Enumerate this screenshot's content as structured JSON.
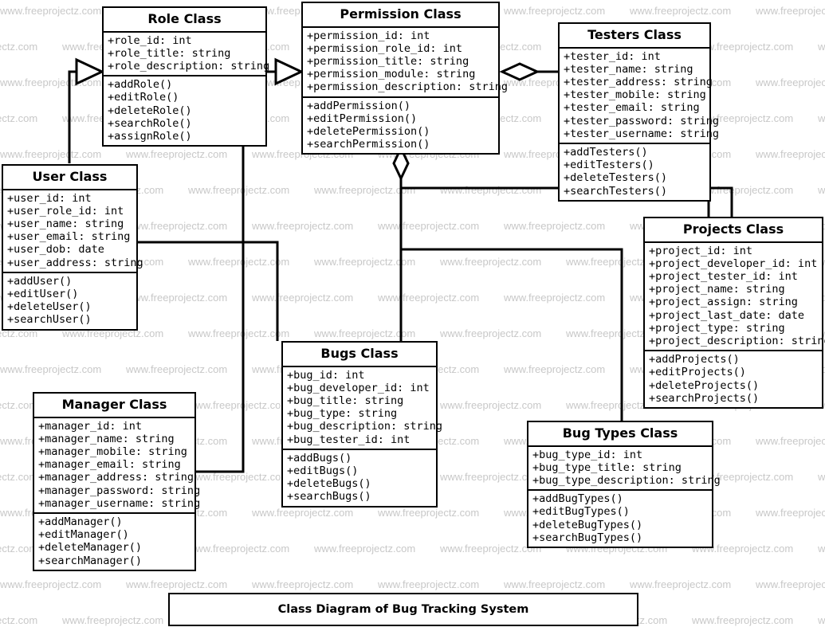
{
  "diagram": {
    "caption": "Class Diagram of Bug Tracking System",
    "watermark_text": "www.freeprojectz.com",
    "line_color": "#000000",
    "box_fill": "#ffffff",
    "watermark_color": "#c8c8c8"
  },
  "classes": {
    "role": {
      "title": "Role Class",
      "attributes": [
        "+role_id: int",
        "+role_title: string",
        "+role_description: string"
      ],
      "methods": [
        "+addRole()",
        "+editRole()",
        "+deleteRole()",
        "+searchRole()",
        "+assignRole()"
      ]
    },
    "permission": {
      "title": "Permission Class",
      "attributes": [
        "+permission_id: int",
        "+permission_role_id: int",
        "+permission_title: string",
        "+permission_module: string",
        "+permission_description: string"
      ],
      "methods": [
        "+addPermission()",
        "+editPermission()",
        "+deletePermission()",
        "+searchPermission()"
      ]
    },
    "testers": {
      "title": "Testers Class",
      "attributes": [
        "+tester_id: int",
        "+tester_name: string",
        "+tester_address: string",
        "+tester_mobile: string",
        "+tester_email: string",
        "+tester_password: string",
        "+tester_username: string"
      ],
      "methods": [
        "+addTesters()",
        "+editTesters()",
        "+deleteTesters()",
        "+searchTesters()"
      ]
    },
    "user": {
      "title": "User Class",
      "attributes": [
        "+user_id: int",
        "+user_role_id: int",
        "+user_name: string",
        "+user_email: string",
        "+user_dob: date",
        "+user_address: string"
      ],
      "methods": [
        "+addUser()",
        "+editUser()",
        "+deleteUser()",
        "+searchUser()"
      ]
    },
    "projects": {
      "title": "Projects Class",
      "attributes": [
        "+project_id: int",
        "+project_developer_id: int",
        "+project_tester_id: int",
        "+project_name: string",
        "+project_assign: string",
        "+project_last_date: date",
        "+project_type: string",
        "+project_description: string"
      ],
      "methods": [
        "+addProjects()",
        "+editProjects()",
        "+deleteProjects()",
        "+searchProjects()"
      ]
    },
    "bugs": {
      "title": "Bugs Class",
      "attributes": [
        "+bug_id: int",
        "+bug_developer_id: int",
        "+bug_title: string",
        "+bug_type: string",
        "+bug_description: string",
        "+bug_tester_id: int"
      ],
      "methods": [
        "+addBugs()",
        "+editBugs()",
        "+deleteBugs()",
        "+searchBugs()"
      ]
    },
    "manager": {
      "title": "Manager Class",
      "attributes": [
        "+manager_id: int",
        "+manager_name: string",
        "+manager_mobile: string",
        "+manager_email: string",
        "+manager_address: string",
        "+manager_password: string",
        "+manager_username: string"
      ],
      "methods": [
        "+addManager()",
        "+editManager()",
        "+deleteManager()",
        "+searchManager()"
      ]
    },
    "bugtypes": {
      "title": "Bug Types Class",
      "attributes": [
        "+bug_type_id: int",
        "+bug_type_title: string",
        "+bug_type_description: string"
      ],
      "methods": [
        "+addBugTypes()",
        "+editBugTypes()",
        "+deleteBugTypes()",
        "+searchBugTypes()"
      ]
    }
  },
  "relationships": [
    {
      "from": "user",
      "to": "role",
      "marker": "hollow-triangle"
    },
    {
      "from": "role",
      "to": "permission",
      "marker": "hollow-triangle"
    },
    {
      "from": "testers",
      "to": "permission",
      "marker": "hollow-diamond"
    },
    {
      "from": "permission",
      "to": "bugs",
      "marker": "hollow-diamond"
    },
    {
      "from": "permission",
      "to": "projects",
      "marker": "none"
    },
    {
      "from": "permission",
      "to": "bugtypes",
      "marker": "none"
    },
    {
      "from": "user",
      "to": "bugs",
      "marker": "none"
    },
    {
      "from": "role",
      "to": "manager",
      "marker": "none"
    }
  ]
}
